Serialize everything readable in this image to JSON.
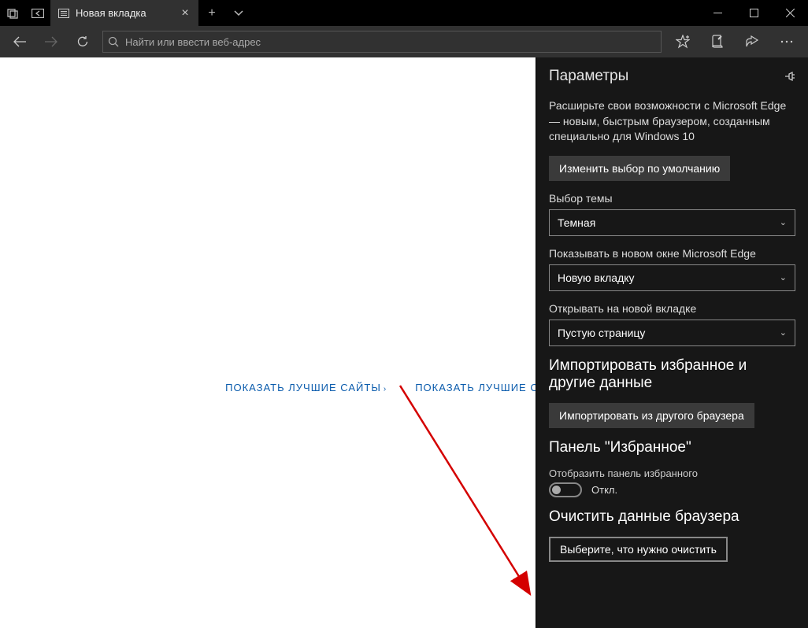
{
  "tab": {
    "title": "Новая вкладка"
  },
  "addressbar": {
    "placeholder": "Найти или ввести веб-адрес"
  },
  "page": {
    "link1": "ПОКАЗАТЬ ЛУЧШИЕ САЙТЫ",
    "link2": "ПОКАЗАТЬ ЛУЧШИЕ САЙТЫ И"
  },
  "panel": {
    "title": "Параметры",
    "promo": "Расширьте свои возможности с Microsoft Edge — новым, быстрым браузером, созданным специально для Windows 10",
    "change_default_btn": "Изменить выбор по умолчанию",
    "theme_label": "Выбор темы",
    "theme_value": "Темная",
    "new_window_label": "Показывать в новом окне Microsoft Edge",
    "new_window_value": "Новую вкладку",
    "new_tab_label": "Открывать на новой вкладке",
    "new_tab_value": "Пустую страницу",
    "import_head": "Импортировать избранное и другие данные",
    "import_btn": "Импортировать из другого браузера",
    "fav_head": "Панель \"Избранное\"",
    "fav_toggle_label": "Отобразить панель избранного",
    "fav_toggle_state": "Откл.",
    "clear_head": "Очистить данные браузера",
    "clear_btn": "Выберите, что нужно очистить"
  }
}
